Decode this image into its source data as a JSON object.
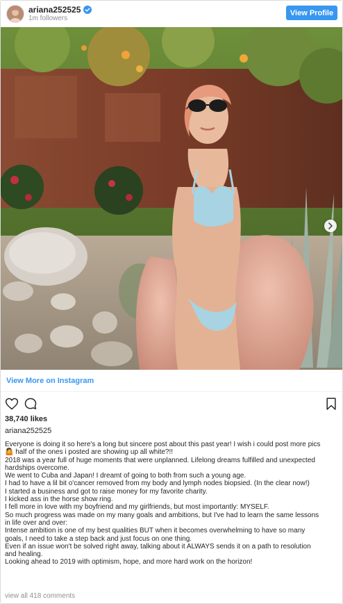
{
  "header": {
    "username": "ariana252525",
    "followers": "1m followers",
    "view_profile_label": "View Profile",
    "verified_icon": "verified-badge-icon",
    "accent_color": "#3897f0"
  },
  "post": {
    "image_alt": "Woman in light blue bikini and pink faux fur coat with sunglasses in a desert garden",
    "carousel_icon": "chevron-right-icon"
  },
  "view_more_label": "View More on Instagram",
  "actions": {
    "like_icon": "heart-icon",
    "comment_icon": "comment-icon",
    "save_icon": "bookmark-icon"
  },
  "likes": "38,740 likes",
  "caption_username": "ariana252525",
  "caption_lines": [
    "Everyone is doing it so here's a long but sincere post about this past year! I wish i could post more pics",
    "🤷 half of the ones i posted are showing up all white?!!",
    "2018 was a year full of huge moments that were unplanned. Lifelong dreams fulfilled and unexpected",
    "hardships overcome.",
    "We went to Cuba and Japan! I dreamt of going to both from such a young age.",
    "I had to have a lil bit o'cancer removed from my body and lymph nodes biopsied. (In the clear now!)",
    "I started a business and got to raise money for my favorite charity.",
    "I kicked ass in the horse show ring.",
    "I fell more in love with my boyfriend and my girlfriends, but most importantly: MYSELF.",
    "So much progress was made on my many goals and ambitions, but I've had to learn the same lessons",
    "in life over and over:",
    "Intense ambition is one of my best qualities BUT when it becomes overwhelming to have so many",
    "goals, I need to take a step back and just focus on one thing.",
    "Even if an issue won't be solved right away, talking about it ALWAYS sends it on a path to resolution",
    "and healing.",
    "Looking ahead to 2019 with optimism, hope, and more hard work on the horizon!"
  ],
  "comments_label": "view all 418 comments"
}
